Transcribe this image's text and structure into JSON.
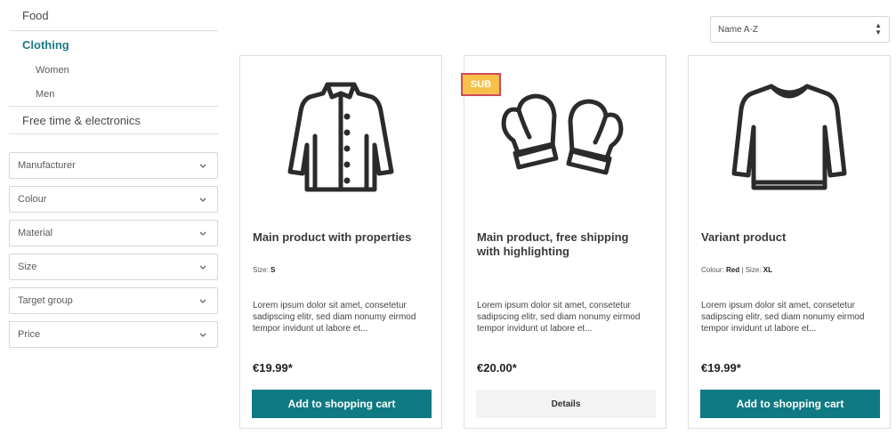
{
  "sidebar": {
    "categories": {
      "food": "Food",
      "clothing": "Clothing",
      "women": "Women",
      "men": "Men",
      "free_time": "Free time & electronics"
    },
    "filters": [
      "Manufacturer",
      "Colour",
      "Material",
      "Size",
      "Target group",
      "Price"
    ]
  },
  "sort": {
    "selected": "Name A-Z",
    "icon": "sort-arrows-icon"
  },
  "products": [
    {
      "title": "Main product with properties",
      "props": [
        {
          "label": "Size:",
          "value": "S"
        }
      ],
      "description": "Lorem ipsum dolor sit amet, consetetur sadipscing elitr, sed diam nonumy eirmod tempor invidunt ut labore et...",
      "price": "€19.99*",
      "button": "Add to shopping cart",
      "icon": "jacket-icon"
    },
    {
      "badge": "SUB",
      "title": "Main product, free shipping with highlighting",
      "description": "Lorem ipsum dolor sit amet, consetetur sadipscing elitr, sed diam nonumy eirmod tempor invidunt ut labore et...",
      "price": "€20.00*",
      "button": "Details",
      "icon": "mittens-icon"
    },
    {
      "title": "Variant product",
      "props": [
        {
          "label": "Colour:",
          "value": "Red"
        },
        {
          "label": "Size:",
          "value": "XL"
        }
      ],
      "description": "Lorem ipsum dolor sit amet, consetetur sadipscing elitr, sed diam nonumy eirmod tempor invidunt ut labore et...",
      "price": "€19.99*",
      "button": "Add to shopping cart",
      "icon": "long-sleeve-shirt-icon"
    }
  ],
  "colors": {
    "accent": "#0f7a82",
    "category_active": "#1e7a82",
    "badge_bg": "#f6c04a",
    "badge_border": "#d04a5a"
  }
}
